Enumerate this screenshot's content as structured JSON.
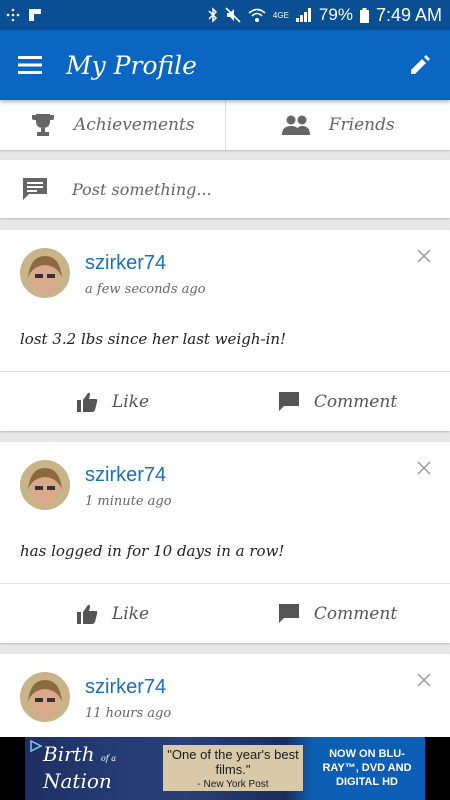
{
  "status_bar": {
    "battery_percent": "79%",
    "time": "7:49 AM",
    "network": "4GE"
  },
  "app_bar": {
    "title": "My Profile",
    "menu_icon": "hamburger-menu-icon",
    "edit_icon": "pencil-icon"
  },
  "tabs": [
    {
      "label": "Achievements",
      "icon": "trophy-icon"
    },
    {
      "label": "Friends",
      "icon": "people-icon"
    }
  ],
  "composer": {
    "placeholder": "Post something...",
    "icon": "comment-icon"
  },
  "feed": [
    {
      "username": "szirker74",
      "time": "a few seconds ago",
      "text": "lost 3.2 lbs since her last weigh-in!"
    },
    {
      "username": "szirker74",
      "time": "1 minute ago",
      "text": "has logged in for 10 days in a row!"
    },
    {
      "username": "szirker74",
      "time": "11 hours ago",
      "text": ""
    }
  ],
  "actions": {
    "like_label": "Like",
    "comment_label": "Comment"
  },
  "ad": {
    "title_line1": "Birth",
    "title_small": "of a",
    "title_line2": "Nation",
    "quote": "\"One of the year's best films.\"",
    "quote_source": "- New York Post",
    "cta": "NOW ON BLU-RAY™, DVD AND DIGITAL HD"
  },
  "colors": {
    "status_bar": "#0a4f94",
    "app_bar": "#0a66c2",
    "username": "#1a6fc0",
    "background": "#e8e8e8"
  }
}
